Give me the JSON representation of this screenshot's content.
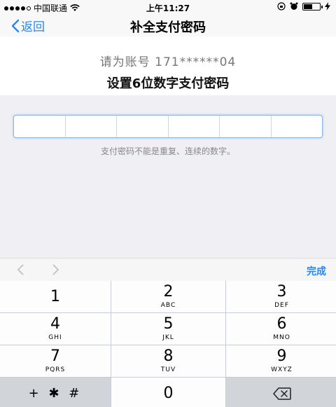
{
  "status_bar": {
    "carrier": "中国联通",
    "time": "上午11:27",
    "battery_level": 0.55
  },
  "nav": {
    "back_label": "返回",
    "title": "补全支付密码"
  },
  "header": {
    "account_line": "请为账号 171******04",
    "instruction": "设置6位数字支付密码"
  },
  "form": {
    "pin_cells": [
      "",
      "",
      "",
      "",
      "",
      ""
    ],
    "hint": "支付密码不能是重复、连续的数字。"
  },
  "toolbar": {
    "done_label": "完成"
  },
  "keypad": {
    "keys": [
      {
        "digit": "1",
        "letters": ""
      },
      {
        "digit": "2",
        "letters": "ABC"
      },
      {
        "digit": "3",
        "letters": "DEF"
      },
      {
        "digit": "4",
        "letters": "GHI"
      },
      {
        "digit": "5",
        "letters": "JKL"
      },
      {
        "digit": "6",
        "letters": "MNO"
      },
      {
        "digit": "7",
        "letters": "PQRS"
      },
      {
        "digit": "8",
        "letters": "TUV"
      },
      {
        "digit": "9",
        "letters": "WXYZ"
      }
    ],
    "symbols_label": "+ ✱ #",
    "zero": "0"
  },
  "colors": {
    "accent": "#2a86f0",
    "form_bg": "#efeff4",
    "keypad_bg": "#c9ccd3"
  }
}
